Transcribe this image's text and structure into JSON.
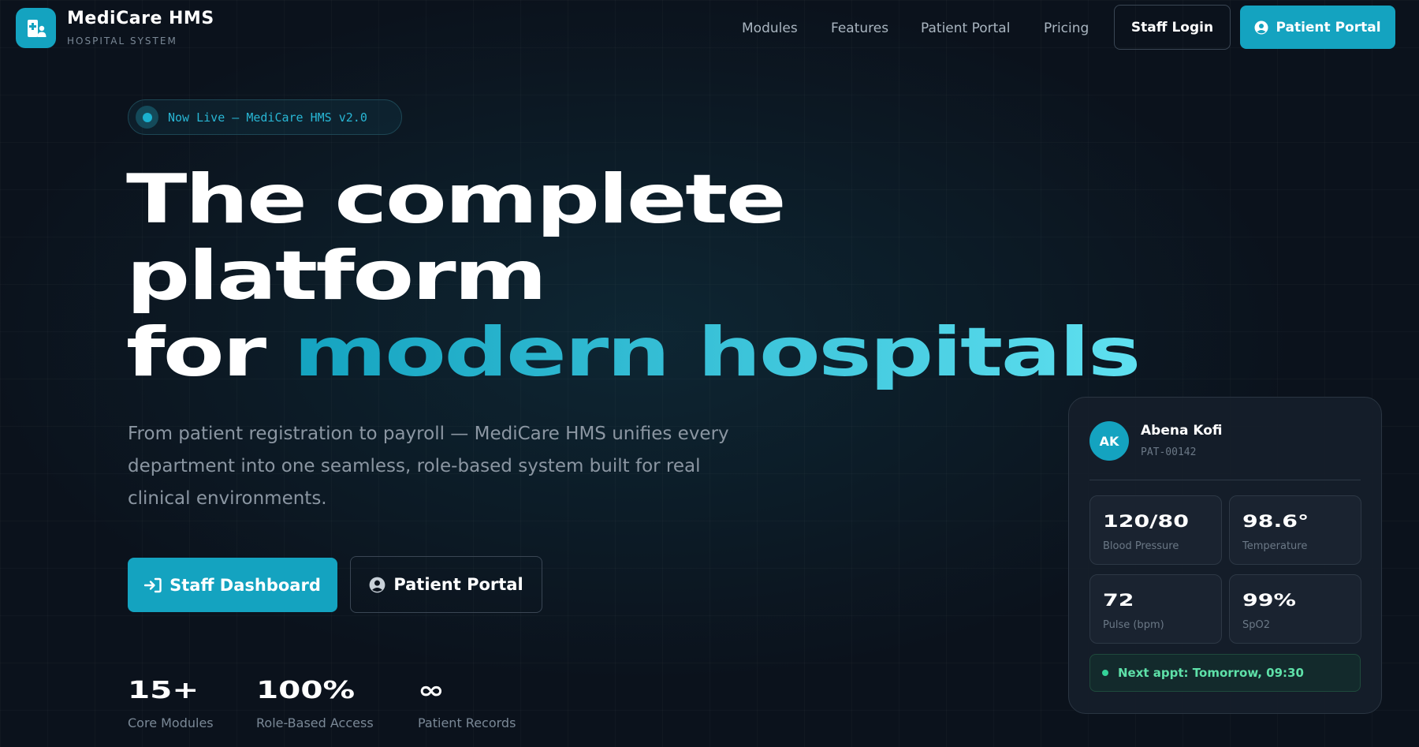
{
  "brand": {
    "name": "MediCare HMS",
    "subtitle": "HOSPITAL SYSTEM",
    "logo_icon": "hospital-user-icon"
  },
  "nav": {
    "links": [
      "Modules",
      "Features",
      "Patient Portal",
      "Pricing"
    ],
    "staff_login": "Staff Login",
    "patient_portal": "Patient Portal"
  },
  "badge": {
    "text": "Now Live — MediCare HMS v2.0"
  },
  "hero": {
    "line1": "The complete",
    "line2": "platform",
    "line3_plain": "for ",
    "line3_accent": "modern hospitals",
    "description": "From patient registration to payroll — MediCare HMS unifies every department into one seamless, role-based system built for real clinical environments.",
    "primary_button": "Staff Dashboard",
    "secondary_button": "Patient Portal"
  },
  "stats": [
    {
      "value": "15+",
      "label": "Core Modules"
    },
    {
      "value": "100%",
      "label": "Role-Based Access"
    },
    {
      "value": "∞",
      "label": "Patient Records"
    }
  ],
  "patient_card": {
    "initials": "AK",
    "name": "Abena Kofi",
    "id": "PAT-00142",
    "vitals": [
      {
        "value": "120/80",
        "label": "Blood Pressure"
      },
      {
        "value": "98.6°",
        "label": "Temperature"
      },
      {
        "value": "72",
        "label": "Pulse (bpm)"
      },
      {
        "value": "99%",
        "label": "SpO2"
      }
    ],
    "next_appointment": "Next appt: Tomorrow, 09:30"
  },
  "colors": {
    "accent": "#14a3c0",
    "accent_light": "#5fe0f0",
    "background": "#0b121c",
    "success": "#34d399"
  }
}
